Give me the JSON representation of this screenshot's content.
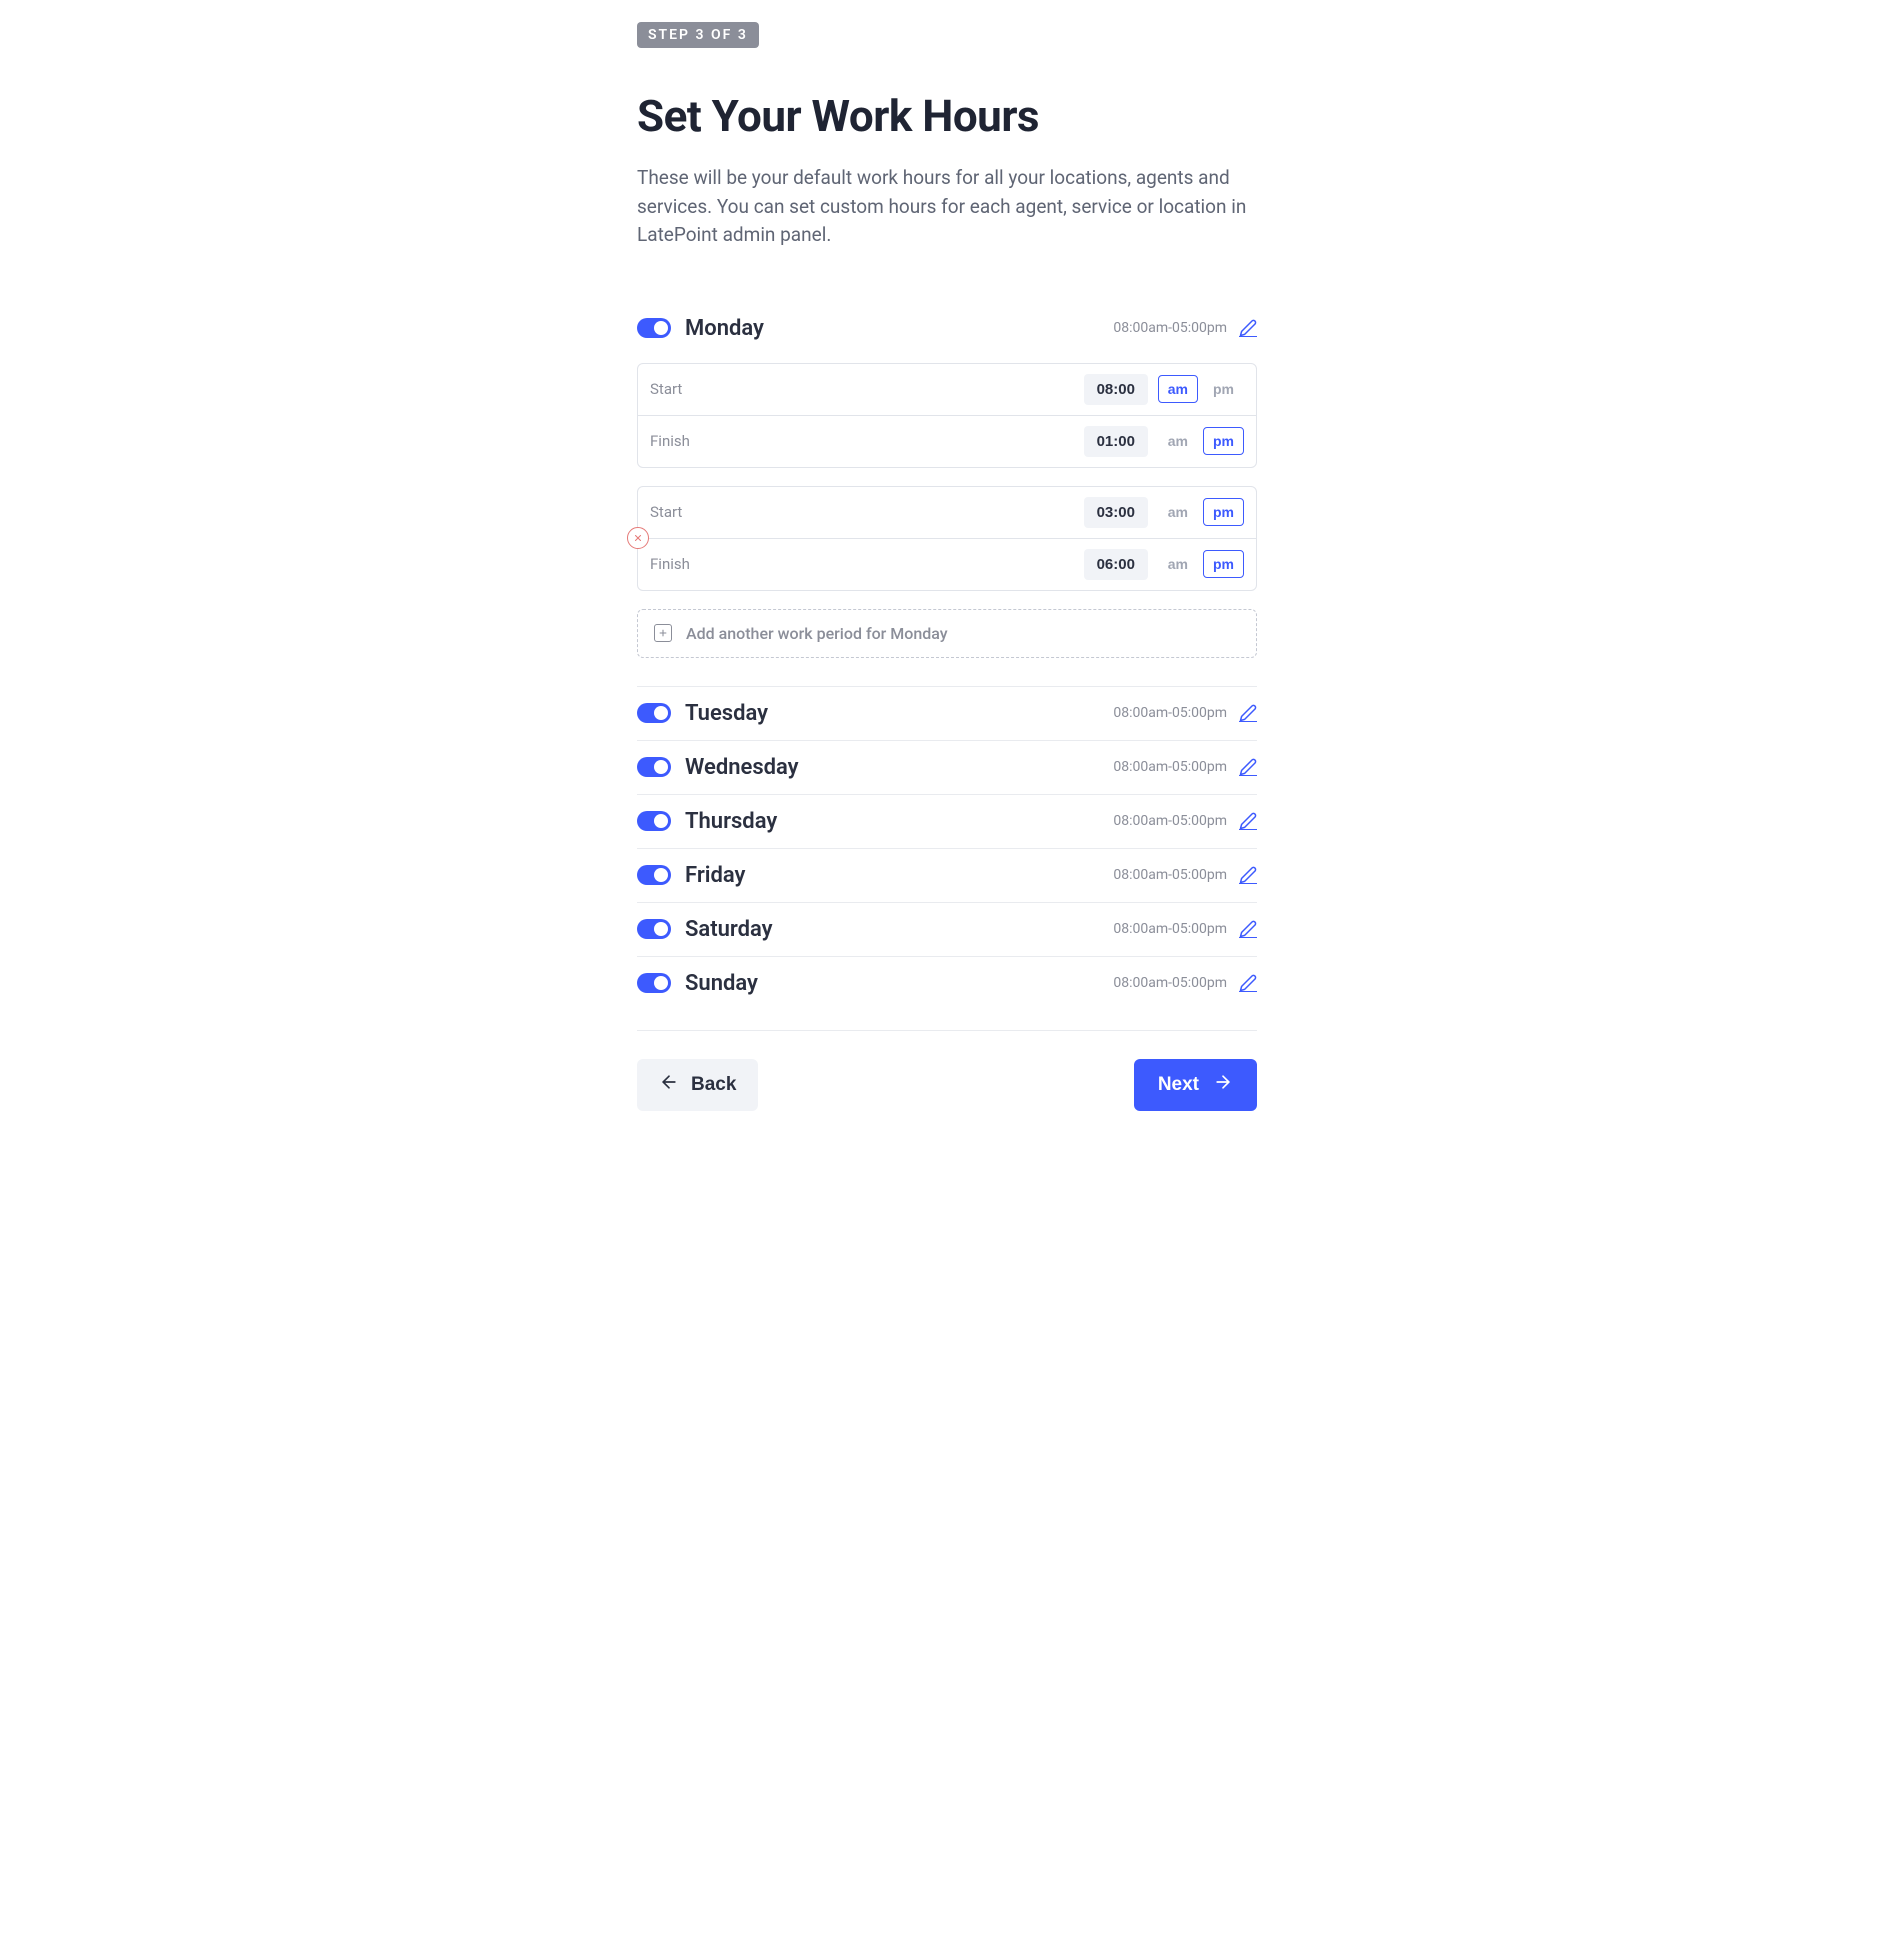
{
  "step_label": "STEP 3 OF 3",
  "title": "Set Your Work Hours",
  "description": "These will be your default work hours for all your locations, agents and services. You can set custom hours for each agent, service or location in LatePoint admin panel.",
  "monday": {
    "name": "Monday",
    "summary": "08:00am-05:00pm",
    "periods": [
      {
        "start_label": "Start",
        "start_time": "08:00",
        "start_ampm": "am",
        "finish_label": "Finish",
        "finish_time": "01:00",
        "finish_ampm": "pm"
      },
      {
        "start_label": "Start",
        "start_time": "03:00",
        "start_ampm": "pm",
        "finish_label": "Finish",
        "finish_time": "06:00",
        "finish_ampm": "pm"
      }
    ],
    "add_another": "Add another work period for Monday"
  },
  "days": [
    {
      "name": "Tuesday",
      "summary": "08:00am-05:00pm"
    },
    {
      "name": "Wednesday",
      "summary": "08:00am-05:00pm"
    },
    {
      "name": "Thursday",
      "summary": "08:00am-05:00pm"
    },
    {
      "name": "Friday",
      "summary": "08:00am-05:00pm"
    },
    {
      "name": "Saturday",
      "summary": "08:00am-05:00pm"
    },
    {
      "name": "Sunday",
      "summary": "08:00am-05:00pm"
    }
  ],
  "ampm": {
    "am": "am",
    "pm": "pm"
  },
  "footer": {
    "back": "Back",
    "next": "Next"
  }
}
